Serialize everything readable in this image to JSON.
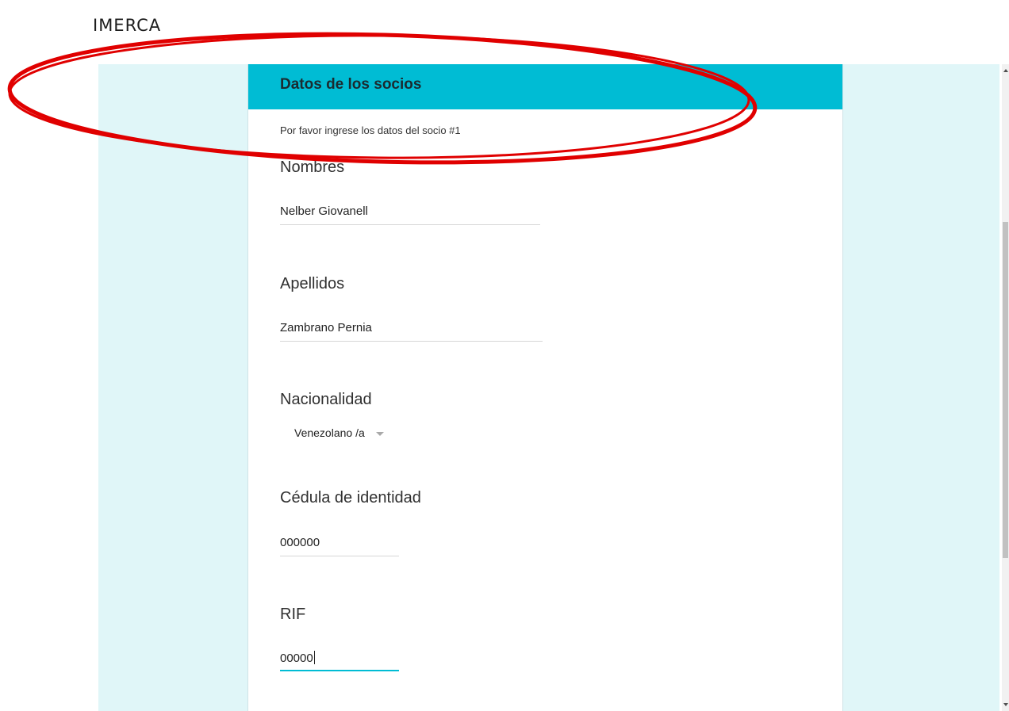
{
  "brand": {
    "text": "IMERCA"
  },
  "form": {
    "title": "Datos de los socios",
    "subtitle": "Por favor ingrese los datos del socio #1",
    "fields": {
      "nombres": {
        "label": "Nombres",
        "value": "Nelber Giovanell"
      },
      "apellidos": {
        "label": "Apellidos",
        "value": "Zambrano Pernia"
      },
      "nacionalidad": {
        "label": "Nacionalidad",
        "value": "Venezolano /a",
        "icon": "chevron-down-icon"
      },
      "cedula": {
        "label": "Cédula de identidad",
        "value": "000000"
      },
      "rif": {
        "label": "RIF",
        "value": "00000"
      }
    }
  },
  "colors": {
    "header": "#00bcd4",
    "background_panel": "#e0f6f8",
    "annotation_ellipse": "#e00000",
    "active_underline": "#00bcd4"
  }
}
